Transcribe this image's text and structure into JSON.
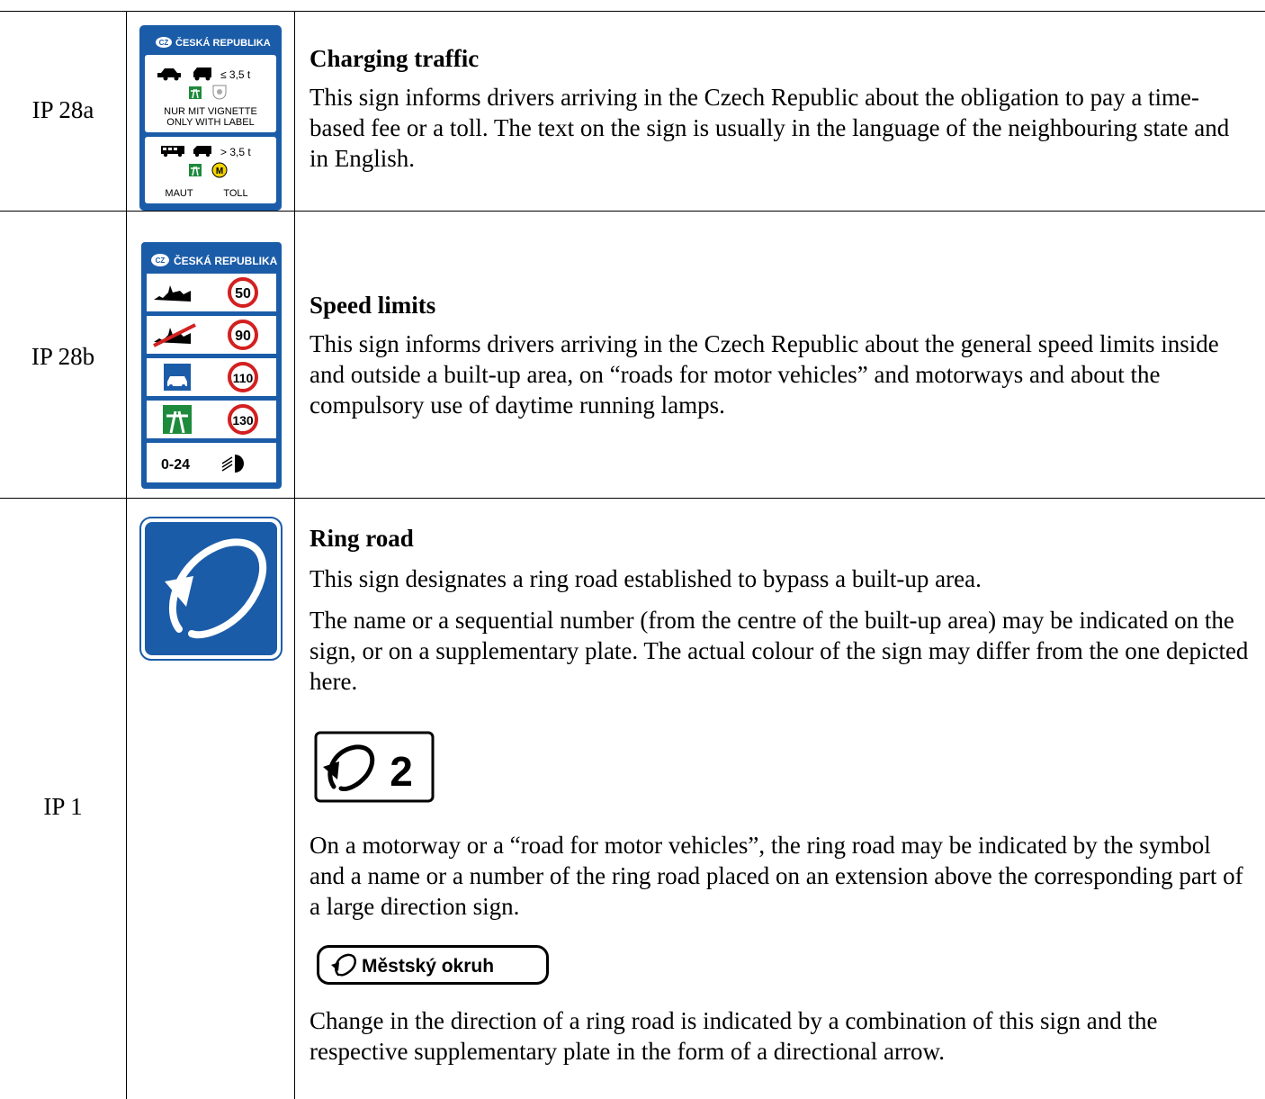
{
  "rows": [
    {
      "code": "IP 28a",
      "title": "Charging traffic",
      "paragraphs": [
        "This sign informs drivers arriving in the Czech Republic about the obligation to pay a time-based fee or a toll. The text on the sign is usually in the language of the neighbouring state and in English."
      ],
      "sign": {
        "country_code": "CZ",
        "country": "ČESKÁ REPUBLIKA",
        "light_weight": "≤ 3,5 t",
        "vignette_line1": "NUR MIT VIGNETTE",
        "vignette_line2": "ONLY WITH LABEL",
        "heavy_weight": "> 3,5 t",
        "toll_badge": "M",
        "toll_left": "MAUT",
        "toll_right": "TOLL"
      }
    },
    {
      "code": "IP 28b",
      "title": "Speed limits",
      "paragraphs": [
        "This sign informs drivers arriving in the Czech Republic about the general speed limits inside and outside a built-up area, on “roads for motor vehicles” and motorways and about the compulsory use of daytime running lamps."
      ],
      "sign": {
        "country_code": "CZ",
        "country": "ČESKÁ REPUBLIKA",
        "limits": [
          "50",
          "90",
          "110",
          "130"
        ],
        "lamps": "0-24"
      }
    },
    {
      "code": "IP 1",
      "title": "Ring road",
      "paragraphs": [
        "This sign designates a ring road established to bypass a built-up area.",
        "The name or a sequential number (from the centre of the built-up area) may be indicated on the sign, or on a supplementary plate. The actual colour of the sign may differ from the one depicted here.",
        "On a motorway or a “road for motor vehicles”, the ring road may be indicated by the symbol and a name or a number of the ring road placed on an extension above the corresponding part of a large direction sign.",
        "Change in the direction of a ring road is indicated by a combination of this sign and the respective supplementary plate in the form of a directional arrow."
      ],
      "plate_number": "2",
      "plate_name": "Městský okruh"
    }
  ],
  "colors": {
    "sign_blue": "#1b5ca8",
    "sign_green": "#1e8a3c",
    "limit_red": "#d32020",
    "badge_yellow": "#f5d300"
  }
}
